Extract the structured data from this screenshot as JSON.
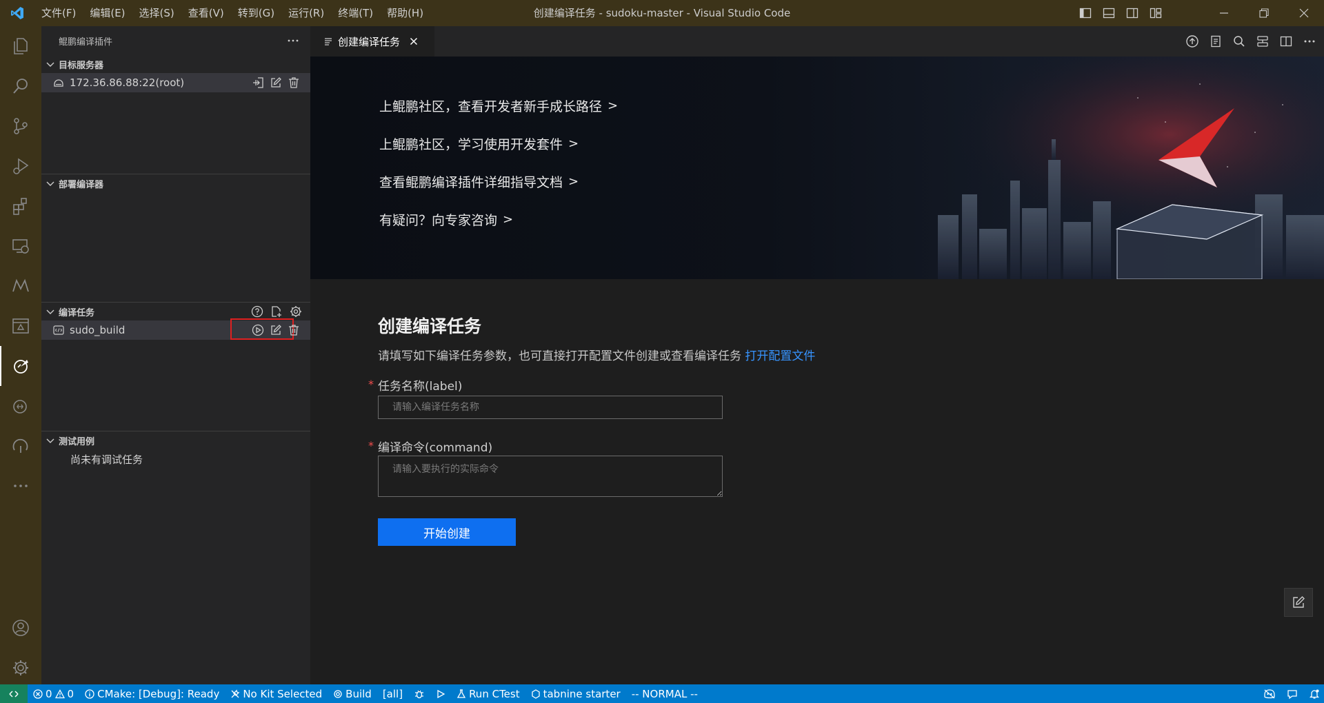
{
  "titlebar": {
    "menu": [
      "文件(F)",
      "编辑(E)",
      "选择(S)",
      "查看(V)",
      "转到(G)",
      "运行(R)",
      "终端(T)",
      "帮助(H)"
    ],
    "window_title": "创建编译任务 - sudoku-master - Visual Studio Code"
  },
  "sidebar": {
    "title": "鲲鹏编译插件",
    "sections": {
      "servers": {
        "title": "目标服务器",
        "items": [
          "172.36.86.88:22(root)"
        ]
      },
      "deploy": {
        "title": "部署编译器"
      },
      "tasks": {
        "title": "编译任务",
        "items": [
          "sudo_build"
        ]
      },
      "tests": {
        "title": "测试用例",
        "empty": "尚未有调试任务"
      }
    }
  },
  "editor": {
    "tab_label": "创建编译任务",
    "banner_links": [
      "上鲲鹏社区，查看开发者新手成长路径",
      "上鲲鹏社区，学习使用开发套件",
      "查看鲲鹏编译插件详细指导文档",
      "有疑问？向专家咨询"
    ],
    "banner_arrow": ">",
    "form": {
      "title": "创建编译任务",
      "desc": "请填写如下编译任务参数，也可直接打开配置文件创建或查看编译任务 ",
      "open_config": "打开配置文件",
      "label_name": "任务名称(label)",
      "placeholder_name": "请输入编译任务名称",
      "label_command": "编译命令(command)",
      "placeholder_command": "请输入要执行的实际命令",
      "required_mark": "*",
      "submit": "开始创建"
    }
  },
  "statusbar": {
    "errors": "0",
    "warnings": "0",
    "cmake": "CMake: [Debug]: Ready",
    "kit": "No Kit Selected",
    "build": "Build",
    "target": "[all]",
    "ctest": "Run CTest",
    "tabnine": "tabnine starter",
    "mode": "-- NORMAL --"
  },
  "colors": {
    "titlebar_bg": "#3c3319",
    "statusbar_bg": "#007acc",
    "primary_button": "#0e6ff0",
    "link": "#3794ff",
    "highlight_box": "#e02020"
  }
}
